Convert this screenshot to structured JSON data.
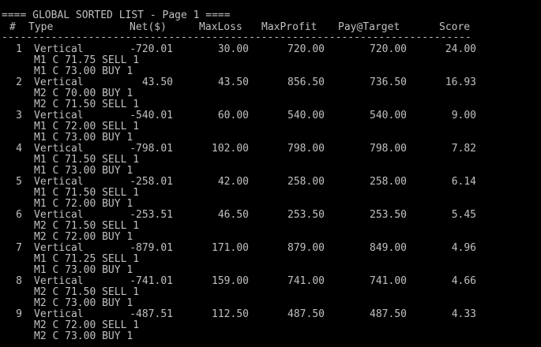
{
  "screen": {
    "title_line": "==== GLOBAL SORTED LIST - Page 1 ====",
    "separator": "-------------------------------------------------------------------------------------------------------",
    "headers": {
      "num": "#",
      "type": "Type",
      "net": "Net($)",
      "maxloss": "MaxLoss",
      "maxprofit": "MaxProfit",
      "pay": "Pay@Target",
      "score": "Score"
    },
    "rows": [
      {
        "num": "1",
        "type": "Vertical",
        "net": "-720.01",
        "maxloss": "30.00",
        "maxprofit": "720.00",
        "pay": "720.00",
        "score": "24.00",
        "leg1": "M1 C 71.75 SELL 1",
        "leg2": "M1 C 73.00 BUY 1"
      },
      {
        "num": "2",
        "type": "Vertical",
        "net": "43.50",
        "maxloss": "43.50",
        "maxprofit": "856.50",
        "pay": "736.50",
        "score": "16.93",
        "leg1": "M2 C 70.00 BUY 1",
        "leg2": "M2 C 71.50 SELL 1"
      },
      {
        "num": "3",
        "type": "Vertical",
        "net": "-540.01",
        "maxloss": "60.00",
        "maxprofit": "540.00",
        "pay": "540.00",
        "score": "9.00",
        "leg1": "M1 C 72.00 SELL 1",
        "leg2": "M1 C 73.00 BUY 1"
      },
      {
        "num": "4",
        "type": "Vertical",
        "net": "-798.01",
        "maxloss": "102.00",
        "maxprofit": "798.00",
        "pay": "798.00",
        "score": "7.82",
        "leg1": "M1 C 71.50 SELL 1",
        "leg2": "M1 C 73.00 BUY 1"
      },
      {
        "num": "5",
        "type": "Vertical",
        "net": "-258.01",
        "maxloss": "42.00",
        "maxprofit": "258.00",
        "pay": "258.00",
        "score": "6.14",
        "leg1": "M1 C 71.50 SELL 1",
        "leg2": "M1 C 72.00 BUY 1"
      },
      {
        "num": "6",
        "type": "Vertical",
        "net": "-253.51",
        "maxloss": "46.50",
        "maxprofit": "253.50",
        "pay": "253.50",
        "score": "5.45",
        "leg1": "M2 C 71.50 SELL 1",
        "leg2": "M2 C 72.00 BUY 1"
      },
      {
        "num": "7",
        "type": "Vertical",
        "net": "-879.01",
        "maxloss": "171.00",
        "maxprofit": "879.00",
        "pay": "849.00",
        "score": "4.96",
        "leg1": "M1 C 71.25 SELL 1",
        "leg2": "M1 C 73.00 BUY 1"
      },
      {
        "num": "8",
        "type": "Vertical",
        "net": "-741.01",
        "maxloss": "159.00",
        "maxprofit": "741.00",
        "pay": "741.00",
        "score": "4.66",
        "leg1": "M2 C 71.50 SELL 1",
        "leg2": "M2 C 73.00 BUY 1"
      },
      {
        "num": "9",
        "type": "Vertical",
        "net": "-487.51",
        "maxloss": "112.50",
        "maxprofit": "487.50",
        "pay": "487.50",
        "score": "4.33",
        "leg1": "M2 C 72.00 SELL 1",
        "leg2": "M2 C 73.00 BUY 1"
      }
    ]
  }
}
